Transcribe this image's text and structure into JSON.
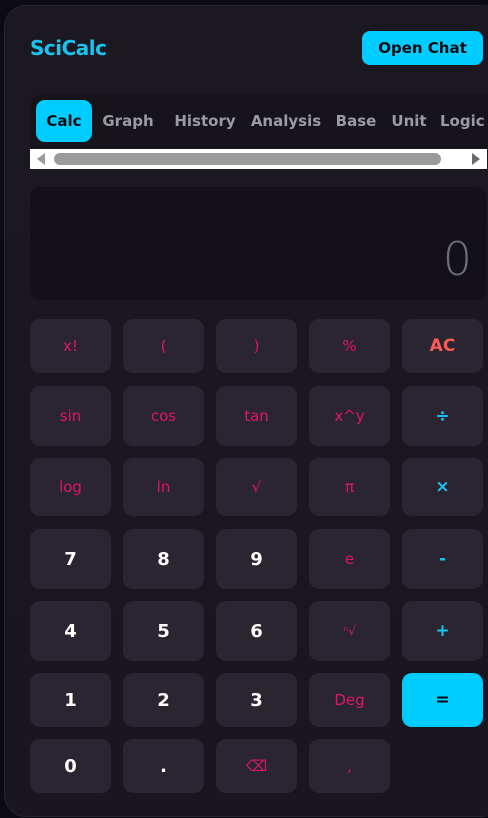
{
  "app": {
    "title": "SciCalc",
    "chat_button": "Open Chat"
  },
  "tabs": [
    "Calc",
    "Graph",
    "History",
    "Analysis",
    "Base",
    "Unit",
    "Logic"
  ],
  "active_tab": 0,
  "display": {
    "value": "0"
  },
  "keys": [
    [
      "x!",
      "(",
      ")",
      "%",
      "AC"
    ],
    [
      "sin",
      "cos",
      "tan",
      "x^y",
      "÷"
    ],
    [
      "log",
      "ln",
      "√",
      "π",
      "×"
    ],
    [
      "7",
      "8",
      "9",
      "e",
      "-"
    ],
    [
      "4",
      "5",
      "6",
      "ⁿ√",
      "+"
    ],
    [
      "1",
      "2",
      "3",
      "Deg",
      "="
    ],
    [
      "0",
      ".",
      "⌫",
      ","
    ]
  ],
  "colors": {
    "accent": "#00ccff",
    "function": "#e0146b",
    "clear": "#ff5a5a",
    "background": "#1c1822"
  }
}
